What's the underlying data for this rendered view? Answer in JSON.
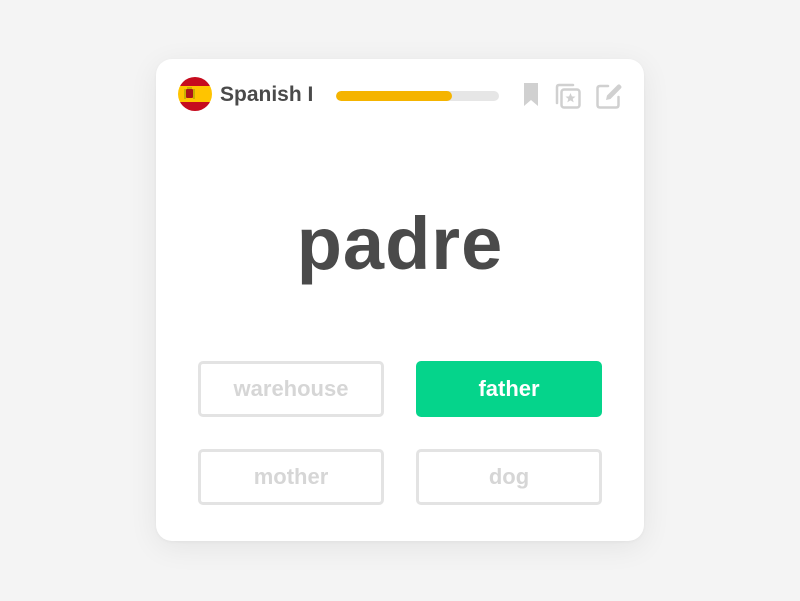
{
  "header": {
    "flag_icon": "spain-flag-icon",
    "course_title": "Spanish I",
    "progress_fraction": 0.71,
    "progress_color": "#f5b400",
    "icons": [
      "bookmark-icon",
      "starred-cards-icon",
      "edit-icon"
    ]
  },
  "card": {
    "word": "padre"
  },
  "options": [
    {
      "label": "warehouse",
      "state": "dimmed"
    },
    {
      "label": "father",
      "state": "correct"
    },
    {
      "label": "mother",
      "state": "dimmed"
    },
    {
      "label": "dog",
      "state": "dimmed"
    }
  ],
  "colors": {
    "correct": "#05d48b",
    "text": "#4a4a4a",
    "dimmed_text": "#d6d6d6",
    "icon": "#d0d0d0"
  }
}
